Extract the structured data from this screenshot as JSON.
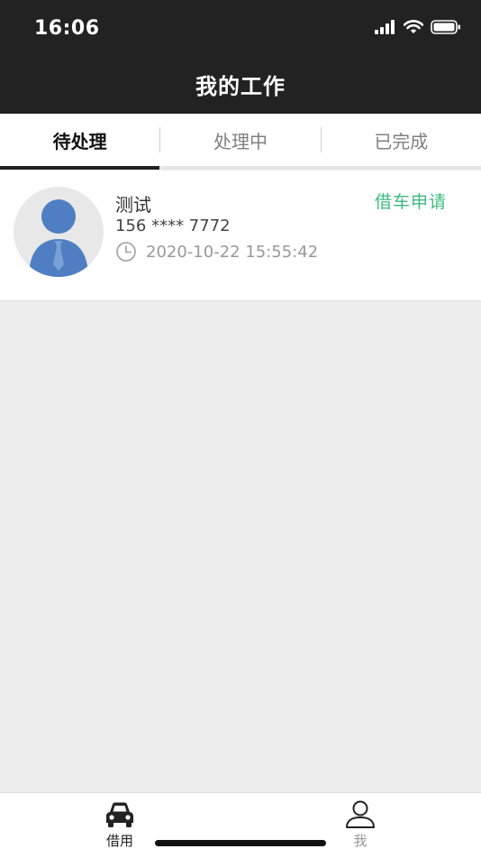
{
  "status_bar": {
    "time": "16:06"
  },
  "nav": {
    "title": "我的工作"
  },
  "tabs": [
    {
      "label": "待处理",
      "active": true
    },
    {
      "label": "处理中",
      "active": false
    },
    {
      "label": "已完成",
      "active": false
    }
  ],
  "items": [
    {
      "name": "测试",
      "phone": "156 **** 7772",
      "time": "2020-10-22 15:55:42",
      "type": "借车申请",
      "avatar_icon": "person-avatar-icon",
      "time_icon": "clock-icon"
    }
  ],
  "tabbar": {
    "items": [
      {
        "label": "借用",
        "icon": "car-icon",
        "active": true
      },
      {
        "label": "我",
        "icon": "person-icon",
        "active": false
      }
    ]
  },
  "colors": {
    "header": "#222222",
    "accent_green": "#3dbb7f",
    "background": "#ededed"
  }
}
